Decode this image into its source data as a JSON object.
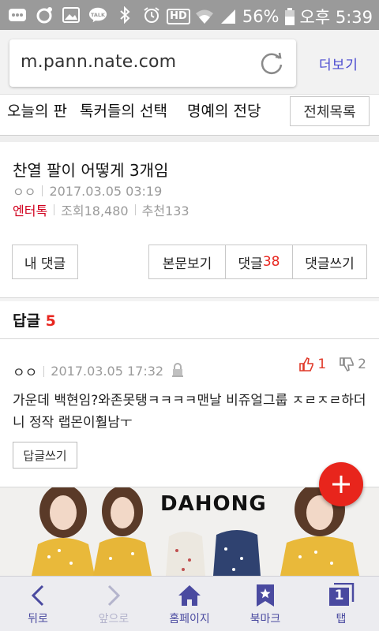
{
  "status_bar": {
    "battery": "56%",
    "time": "오후 5:39",
    "hd_label": "HD",
    "talk_label": "TALK"
  },
  "browser": {
    "url": "m.pann.nate.com",
    "more_label": "더보기"
  },
  "top_nav": {
    "tabs": [
      "오늘의 판",
      "톡커들의 선택",
      "명예의 전당"
    ],
    "all_list_label": "전체목록"
  },
  "article": {
    "title": "찬열 팔이 어떻게 3개임",
    "author": "ㅇㅇ",
    "date": "2017.03.05 03:19",
    "category": "엔터톡",
    "views": "조회18,480",
    "recommends": "추천133"
  },
  "article_buttons": {
    "my_comments": "내 댓글",
    "view_body": "본문보기",
    "comments_label": "댓글",
    "comments_count": "38",
    "write_comment": "댓글쓰기"
  },
  "replies": {
    "label": "답글",
    "count": "5"
  },
  "comment": {
    "author": "ㅇㅇ",
    "date": "2017.03.05 17:32",
    "up_votes": "1",
    "down_votes": "2",
    "body": "가운데 백현임?와존못탱ㅋㅋㅋㅋ맨날 비쥬얼그룹 ㅈㄹㅈㄹ하더니 정작 랩몬이훨남ㅜ",
    "reply_button": "답글쓰기"
  },
  "ad": {
    "brand": "DAHONG"
  },
  "bottom_bar": {
    "back": "뒤로",
    "forward": "앞으로",
    "home": "홈페이지",
    "bookmark": "북마크",
    "tabs": "탭",
    "tab_count": "1"
  },
  "colors": {
    "accent_red": "#e8261f",
    "category_red": "#d1001e",
    "toolbar_blue": "#4a4aa0",
    "status_bar_gray": "#9a9a9a"
  }
}
